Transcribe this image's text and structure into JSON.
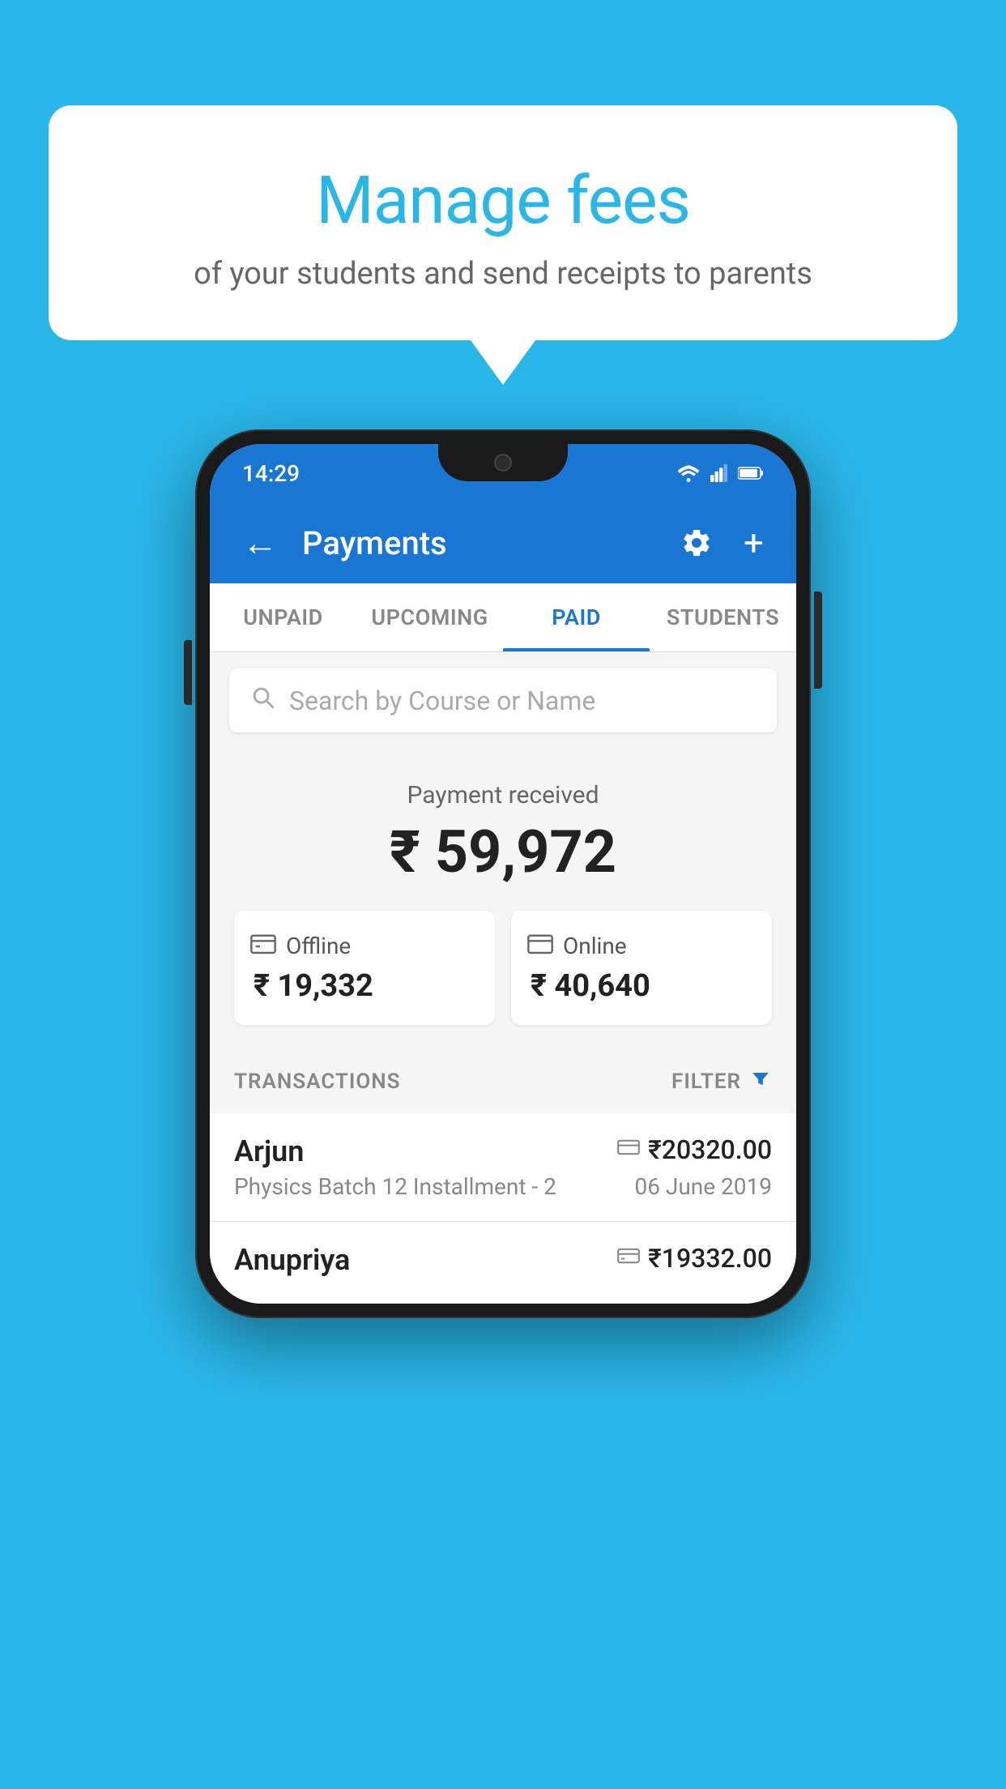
{
  "background_color": "#29B6E8",
  "hero": {
    "title": "Manage fees",
    "subtitle": "of your students and send receipts to parents"
  },
  "status_bar": {
    "time": "14:29",
    "icons": [
      "wifi",
      "signal",
      "battery"
    ]
  },
  "app_bar": {
    "title": "Payments",
    "back_label": "←",
    "add_label": "+"
  },
  "tabs": [
    {
      "label": "UNPAID",
      "active": false
    },
    {
      "label": "UPCOMING",
      "active": false
    },
    {
      "label": "PAID",
      "active": true
    },
    {
      "label": "STUDENTS",
      "active": false
    }
  ],
  "search": {
    "placeholder": "Search by Course or Name"
  },
  "payment_summary": {
    "label": "Payment received",
    "total": "₹ 59,972",
    "offline_label": "Offline",
    "offline_amount": "₹ 19,332",
    "online_label": "Online",
    "online_amount": "₹ 40,640"
  },
  "transactions": {
    "header": "TRANSACTIONS",
    "filter_label": "FILTER",
    "rows": [
      {
        "name": "Arjun",
        "course": "Physics Batch 12 Installment - 2",
        "amount": "₹20320.00",
        "date": "06 June 2019",
        "payment_type": "online"
      },
      {
        "name": "Anupriya",
        "course": "",
        "amount": "₹19332.00",
        "date": "",
        "payment_type": "offline"
      }
    ]
  }
}
